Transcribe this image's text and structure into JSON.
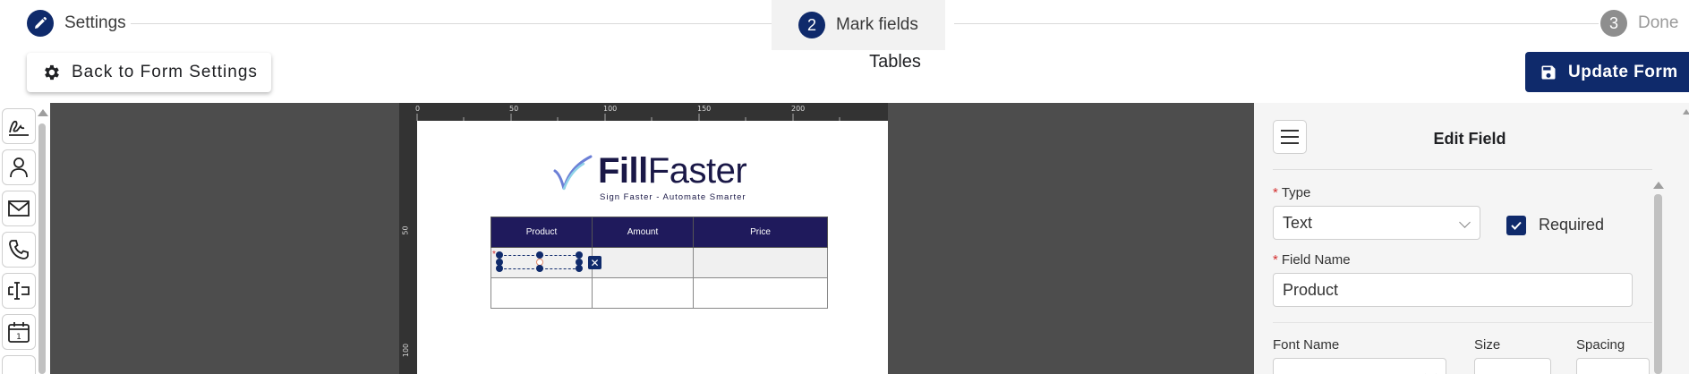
{
  "stepper": {
    "steps": [
      {
        "number": "",
        "label": "Settings",
        "icon": "pencil-icon",
        "state": "completed"
      },
      {
        "number": "2",
        "label": "Mark fields",
        "state": "active"
      },
      {
        "number": "3",
        "label": "Done",
        "state": "pending"
      }
    ]
  },
  "toolbar": {
    "back_label": "Back to Form Settings",
    "back_icon": "gear-icon",
    "title": "Tables",
    "update_label": "Update Form",
    "update_icon": "save-icon"
  },
  "tools": [
    "signature-icon",
    "person-icon",
    "email-icon",
    "phone-icon",
    "text-field-icon",
    "calendar-icon"
  ],
  "ruler": {
    "top_labels": [
      "0",
      "50",
      "100",
      "150",
      "200"
    ],
    "left_labels": [
      "50",
      "100"
    ]
  },
  "document": {
    "logo_bold": "Fill",
    "logo_light": "Faster",
    "tagline": "Sign Faster - Automate Smarter",
    "table_headers": [
      "Product",
      "Amount",
      "Price"
    ]
  },
  "panel": {
    "title": "Edit Field",
    "type_label": "Type",
    "type_value": "Text",
    "required_label": "Required",
    "required_checked": true,
    "field_name_label": "Field Name",
    "field_name_value": "Product",
    "font_name_label": "Font Name",
    "size_label": "Size",
    "spacing_label": "Spacing"
  },
  "colors": {
    "primary": "#0f2a6b",
    "table_header": "#1f1a5c",
    "canvas": "#4d4d4d",
    "required_star": "#d32f2f"
  }
}
